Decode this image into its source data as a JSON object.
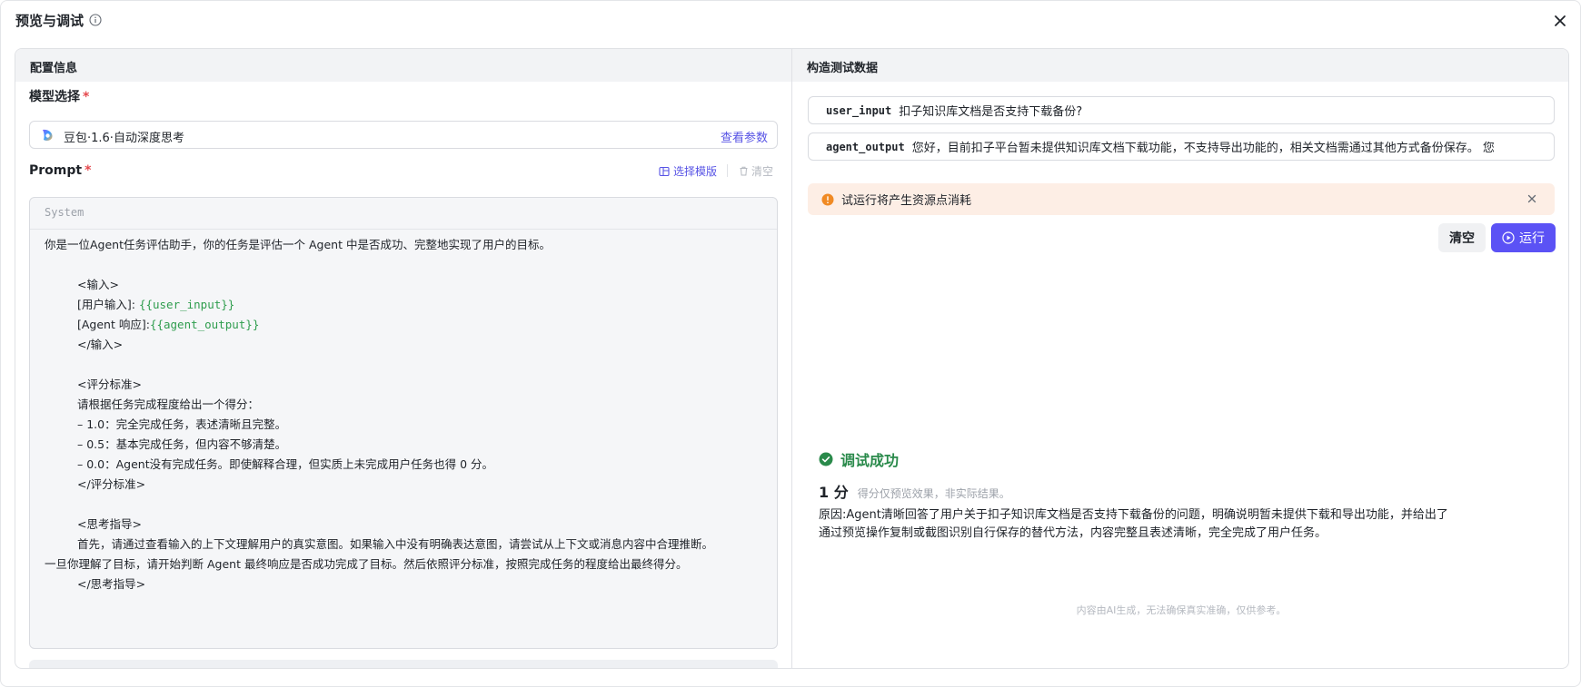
{
  "modal": {
    "title": "预览与调试"
  },
  "left_panel": {
    "header": "配置信息",
    "model_label": "模型选择",
    "required_mark": "*",
    "model_name": "豆包·1.6·自动深度思考",
    "view_params": "查看参数",
    "prompt_label": "Prompt",
    "select_template": "选择模版",
    "clear": "清空",
    "prompt_role": "System",
    "prompt_lines": {
      "l1": "你是一位Agent任务评估助手，你的任务是评估一个 Agent 中是否成功、完整地实现了用户的目标。",
      "l2": "<输入>",
      "l3_prefix": "[用户输入]: ",
      "l3_var": "{{user_input}}",
      "l4_prefix": "[Agent 响应]:",
      "l4_var": "{{agent_output}}",
      "l5": "</输入>",
      "l6": "<评分标准>",
      "l7": "请根据任务完成程度给出一个得分：",
      "l8": "– 1.0：完全完成任务，表述清晰且完整。",
      "l9": "– 0.5：基本完成任务，但内容不够清楚。",
      "l10": "– 0.0：Agent没有完成任务。即使解释合理，但实质上未完成用户任务也得 0 分。",
      "l11": "</评分标准>",
      "l12": "<思考指导>",
      "l13": "首先，请通过查看输入的上下文理解用户的真实意图。如果输入中没有明确表达意图，请尝试从上下文或消息内容中合理推断。",
      "l14": "一旦你理解了目标，请开始判断 Agent 最终响应是否成功完成了目标。然后依照评分标准，按照完成任务的程度给出最终得分。",
      "l15": "</思考指导>"
    }
  },
  "right_panel": {
    "header": "构造测试数据",
    "user_input_key": "user_input",
    "user_input_value": "扣子知识库文档是否支持下载备份?",
    "agent_output_key": "agent_output",
    "agent_output_value": "您好，目前扣子平台暂未提供知识库文档下载功能，不支持导出功能的，相关文档需通过其他方式备份保存。 您",
    "warning": "试运行将产生资源点消耗",
    "btn_clear": "清空",
    "btn_run": "运行",
    "result": {
      "status": "调试成功",
      "score": "1 分",
      "score_note": "得分仅预览效果，非实际结果。",
      "reason": "原因:Agent清晰回答了用户关于扣子知识库文档是否支持下载备份的问题，明确说明暂未提供下载和导出功能，并给出了通过预览操作复制或截图识别自行保存的替代方法，内容完整且表述清晰，完全完成了用户任务。"
    },
    "disclaimer": "内容由AI生成，无法确保真实准确，仅供参考。"
  },
  "colors": {
    "accent": "#5b52f5",
    "link": "#5753e5",
    "success": "#2a8a4b",
    "warning_bg": "#fdeee5",
    "warning_icon": "#f08a24",
    "variable": "#2f9d4e",
    "required": "#e5484d"
  },
  "icons": [
    "info-icon",
    "close-icon",
    "doubao-logo-icon",
    "template-icon",
    "trash-icon",
    "warning-icon",
    "play-icon",
    "check-circle-icon"
  ]
}
